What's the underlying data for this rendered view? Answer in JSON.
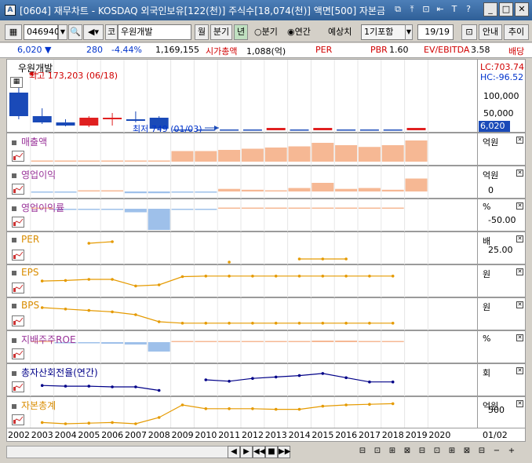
{
  "window": {
    "title": "[0604] 재무차트 - KOSDAQ 외국인보유[122(천)] 주식수[18,074(천)] 액면[500] 자본금",
    "app_icon_text": "A",
    "title_icons": [
      "⧉",
      "⤒",
      "⊡",
      "⇤",
      "T",
      "?"
    ],
    "win_buttons": [
      "_",
      "□",
      "✕"
    ]
  },
  "toolbar": {
    "code": "046940",
    "company_prefix": "코",
    "company_name": "우원개발",
    "btn_month": "월",
    "btn_quarter": "분기",
    "btn_year": "년",
    "radio_quarter": "○분기",
    "radio_annual": "◉연간",
    "estimate_label": "예상치",
    "estimate_value": "1기포함",
    "page": "19/19",
    "guide_button": "안내",
    "add_button": "추이"
  },
  "price": {
    "current": "6,020 ▼",
    "change": "280",
    "change_pct": "-4.44%",
    "volume": "1,169,155",
    "mcap_label": "시가총액",
    "mcap_value": "1,088(억)",
    "per_label": "PER",
    "pbr_label": "PBR",
    "pbr_value": "1.60",
    "ev_label": "EV/EBITDA",
    "ev_value": "3.58",
    "dividend_label": "배당"
  },
  "main_chart": {
    "name": "우원개발",
    "high_label": "최고 173,203 (06/18)",
    "low_label": "최저 749 (01/03)",
    "lc": "LC:703.74",
    "hc": "HC:-96.52",
    "ticks": [
      "100,000",
      "50,000"
    ],
    "price_tag": "6,020"
  },
  "panes": [
    {
      "title": "매출액",
      "unit": "억원",
      "ticks": [],
      "color": "#993399"
    },
    {
      "title": "영업이익",
      "unit": "억원",
      "ticks": [
        "0"
      ],
      "color": "#993399"
    },
    {
      "title": "영업이익률",
      "unit": "%",
      "ticks": [
        "-50.00"
      ],
      "color": "#993399"
    },
    {
      "title": "PER",
      "unit": "배",
      "ticks": [
        "25.00"
      ],
      "color": "#d98c00"
    },
    {
      "title": "EPS",
      "unit": "원",
      "ticks": [],
      "color": "#d98c00"
    },
    {
      "title": "BPS",
      "unit": "원",
      "ticks": [],
      "color": "#d98c00"
    },
    {
      "title": "지배주주ROE",
      "unit": "%",
      "ticks": [],
      "color": "#993399"
    },
    {
      "title": "총자산회전율(연간)",
      "unit": "회",
      "ticks": [],
      "color": "#000088"
    },
    {
      "title": "자본총계",
      "unit": "억원",
      "ticks": [
        "500"
      ],
      "color": "#d98c00"
    }
  ],
  "chart_data": {
    "type": "bar",
    "categories": [
      "2002",
      "2003",
      "2004",
      "2005",
      "2006",
      "2007",
      "2008",
      "2009",
      "2010",
      "2011",
      "2012",
      "2013",
      "2014",
      "2015",
      "2016",
      "2017",
      "2018",
      "2019",
      "2020"
    ],
    "series": [
      {
        "name": "매출액",
        "values": [
          null,
          0,
          0,
          0,
          0,
          0,
          0,
          18,
          18,
          20,
          22,
          24,
          26,
          32,
          28,
          25,
          28,
          36,
          null
        ]
      },
      {
        "name": "영업이익",
        "values": [
          null,
          -1,
          -1,
          0,
          0,
          -2,
          -2,
          -1,
          -1,
          3,
          2,
          0,
          4,
          10,
          3,
          4,
          2,
          15,
          null
        ]
      },
      {
        "name": "영업이익률",
        "values": [
          null,
          0,
          -1,
          -1,
          -1,
          -5,
          -30,
          -1,
          -1,
          0,
          0,
          0,
          0,
          1,
          0,
          0,
          0,
          null,
          null
        ]
      },
      {
        "name": "PER",
        "values": [
          null,
          null,
          null,
          null,
          null,
          null,
          null,
          null,
          null,
          null,
          null,
          null,
          null,
          null,
          null,
          null,
          null,
          null,
          null
        ]
      },
      {
        "name": "EPS",
        "values": [
          null,
          -3,
          -2,
          0,
          0,
          -12,
          -10,
          5,
          6,
          6,
          6,
          6,
          6,
          6,
          6,
          6,
          6,
          null,
          null
        ]
      },
      {
        "name": "BPS",
        "values": [
          null,
          30,
          29,
          28,
          27,
          25,
          20,
          19,
          19,
          19,
          19,
          19,
          19,
          19,
          19,
          19,
          19,
          null,
          null
        ]
      },
      {
        "name": "지배주주ROE",
        "values": [
          null,
          0,
          -1,
          -1,
          -2,
          -3,
          -12,
          0,
          0,
          0,
          0,
          0,
          0,
          2,
          2,
          0,
          0,
          null,
          null
        ]
      },
      {
        "name": "총자산회전율(연간)",
        "values": [
          null,
          1.2,
          1.1,
          1.1,
          1.0,
          1.0,
          0.5,
          null,
          2.0,
          1.8,
          2.2,
          2.4,
          2.6,
          2.9,
          2.3,
          1.7,
          1.7,
          null,
          null
        ]
      },
      {
        "name": "자본총계",
        "values": [
          null,
          -8,
          -10,
          -9,
          -8,
          -10,
          0,
          20,
          14,
          14,
          14,
          13,
          13,
          18,
          20,
          21,
          22,
          null,
          null
        ]
      }
    ],
    "xlabel": "",
    "ylabel": ""
  },
  "xaxis": {
    "years": [
      "2002",
      "2003",
      "2004",
      "2005",
      "2006",
      "2007",
      "2008",
      "2009",
      "2010",
      "2011",
      "2012",
      "2013",
      "2014",
      "2015",
      "2016",
      "2017",
      "2018",
      "2019",
      "2020"
    ],
    "right_label": "01/02"
  },
  "statusbar": {
    "nav": [
      "◀",
      "▶",
      "◀◀",
      "■",
      "▶▶"
    ],
    "tools": [
      "⊟",
      "⊡",
      "⊞",
      "⊠",
      "⊟",
      "⊡",
      "⊞",
      "⊠",
      "⊟",
      "−",
      "+"
    ]
  }
}
